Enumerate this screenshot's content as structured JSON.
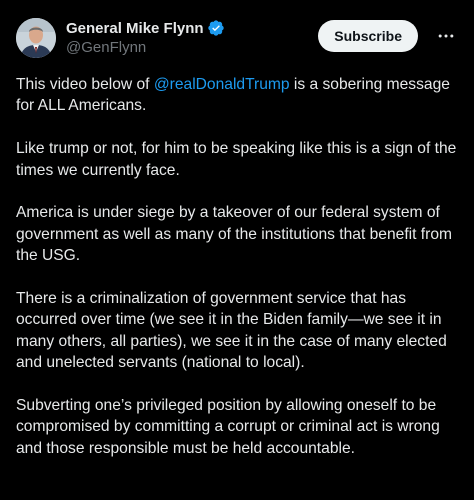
{
  "author": {
    "display_name": "General Mike Flynn",
    "handle": "@GenFlynn",
    "verified": true,
    "verified_icon": "verified-badge-icon",
    "avatar_icon": "profile-avatar"
  },
  "actions": {
    "subscribe_label": "Subscribe",
    "more_icon": "more-horizontal-icon"
  },
  "post": {
    "p1_before": "This video below of ",
    "p1_mention": "@realDonaldTrump",
    "p1_after": " is a sobering message for ALL Americans.",
    "p2": "Like trump or not, for him to be speaking like this is a sign of the times we currently face.",
    "p3": "America is under siege by a takeover of our federal system of government as well as many of the institutions that benefit from the USG.",
    "p4": "There is a criminalization of government service that has occurred over time (we see it in the Biden family—we see it in many others, all parties), we see it in the case of many elected and unelected servants (national to local).",
    "p5": "Subverting one’s privileged position by allowing oneself to be compromised by committing a corrupt or criminal act is wrong and those responsible must be held accountable."
  },
  "colors": {
    "background": "#000000",
    "text": "#e7e9ea",
    "secondary_text": "#71767b",
    "link": "#1d9bf0",
    "verified": "#1d9bf0",
    "button_bg": "#eff3f4"
  }
}
